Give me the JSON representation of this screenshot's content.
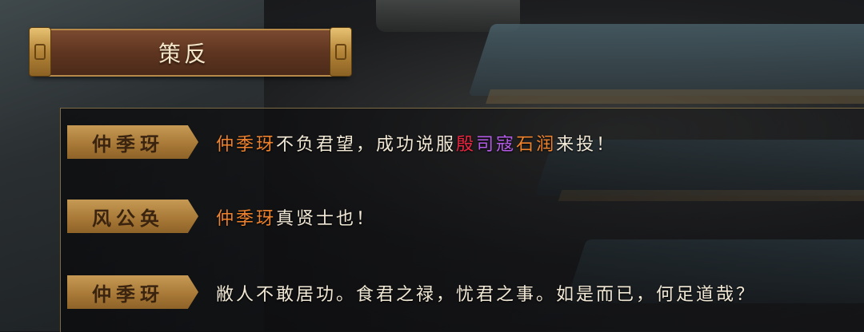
{
  "title": "策反",
  "dialogue": [
    {
      "speaker": "仲季玡",
      "segments": [
        {
          "text": "仲季玡",
          "color": "orange"
        },
        {
          "text": "不负君望，成功说服",
          "color": "white"
        },
        {
          "text": "殷",
          "color": "red"
        },
        {
          "text": "司寇",
          "color": "purple"
        },
        {
          "text": "石润",
          "color": "orange"
        },
        {
          "text": "来投！",
          "color": "white"
        }
      ]
    },
    {
      "speaker": "风公奂",
      "segments": [
        {
          "text": "仲季玡",
          "color": "orange"
        },
        {
          "text": "真贤士也！",
          "color": "white"
        }
      ]
    },
    {
      "speaker": "仲季玡",
      "segments": [
        {
          "text": "敝人不敢居功。食君之禄，忧君之事。如是而已，何足道哉？",
          "color": "white"
        }
      ]
    }
  ],
  "colors": {
    "orange": "#f0822b",
    "red": "#e8253f",
    "purple": "#b45ae8",
    "white": "#f2e8d6"
  }
}
